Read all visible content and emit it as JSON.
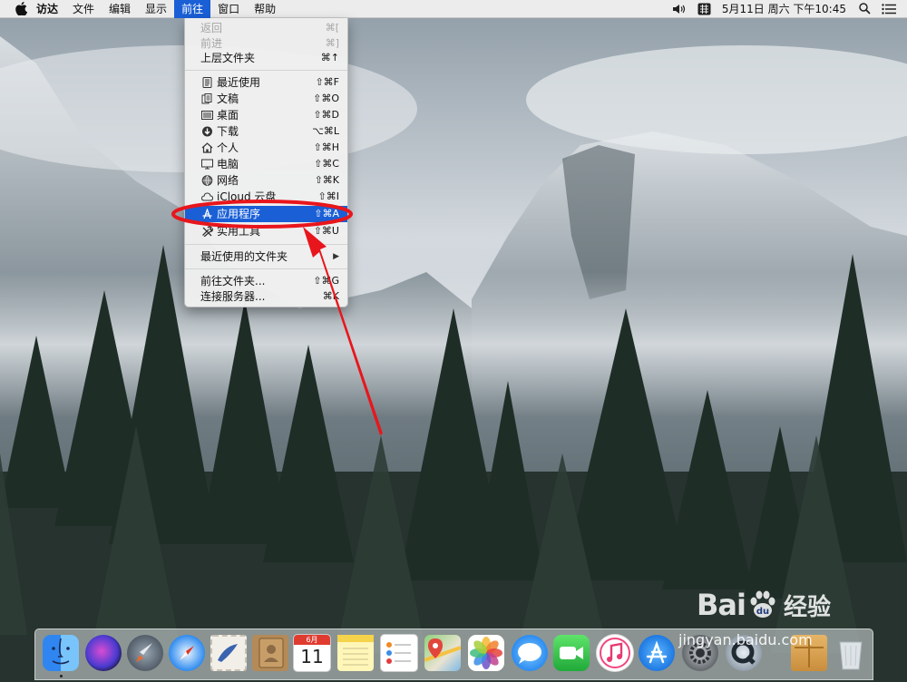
{
  "menubar": {
    "app_name": "访达",
    "items": [
      "文件",
      "编辑",
      "显示",
      "前往",
      "窗口",
      "帮助"
    ],
    "active_item": "前往",
    "clock": "5月11日 周六 下午10:45"
  },
  "go_menu": {
    "items": [
      {
        "label": "返回",
        "shortcut": "⌘[",
        "disabled": true,
        "icon": ""
      },
      {
        "label": "前进",
        "shortcut": "⌘]",
        "disabled": true,
        "icon": ""
      },
      {
        "label": "上层文件夹",
        "shortcut": "⌘↑",
        "disabled": false,
        "icon": ""
      },
      {
        "label": "最近使用",
        "shortcut": "⇧⌘F",
        "disabled": false,
        "icon": "recents-icon"
      },
      {
        "label": "文稿",
        "shortcut": "⇧⌘O",
        "disabled": false,
        "icon": "documents-icon"
      },
      {
        "label": "桌面",
        "shortcut": "⇧⌘D",
        "disabled": false,
        "icon": "desktop-icon"
      },
      {
        "label": "下载",
        "shortcut": "⌥⌘L",
        "disabled": false,
        "icon": "downloads-icon"
      },
      {
        "label": "个人",
        "shortcut": "⇧⌘H",
        "disabled": false,
        "icon": "home-icon"
      },
      {
        "label": "电脑",
        "shortcut": "⇧⌘C",
        "disabled": false,
        "icon": "computer-icon"
      },
      {
        "label": "网络",
        "shortcut": "⇧⌘K",
        "disabled": false,
        "icon": "network-icon"
      },
      {
        "label": "iCloud 云盘",
        "shortcut": "⇧⌘I",
        "disabled": false,
        "icon": "icloud-icon"
      },
      {
        "label": "应用程序",
        "shortcut": "⇧⌘A",
        "disabled": false,
        "icon": "applications-icon",
        "highlighted": true
      },
      {
        "label": "实用工具",
        "shortcut": "⇧⌘U",
        "disabled": false,
        "icon": "utilities-icon"
      },
      {
        "label": "最近使用的文件夹",
        "shortcut": "▶",
        "disabled": false,
        "icon": ""
      },
      {
        "label": "前往文件夹...",
        "shortcut": "⇧⌘G",
        "disabled": false,
        "icon": ""
      },
      {
        "label": "连接服务器...",
        "shortcut": "⌘K",
        "disabled": false,
        "icon": ""
      }
    ]
  },
  "dock": {
    "apps": [
      "finder-icon",
      "siri-icon",
      "launchpad-icon",
      "safari-icon",
      "mail-icon",
      "contacts-icon",
      "calendar-icon",
      "notes-icon",
      "reminders-icon",
      "maps-icon",
      "photos-icon",
      "messages-icon",
      "facetime-icon",
      "music-icon",
      "app-store-icon",
      "system-preferences-icon",
      "quicktime-icon",
      "package-icon",
      "trash-icon"
    ],
    "calendar": {
      "month": "6月",
      "day": "11"
    }
  },
  "watermark": {
    "brand": "Bai",
    "suffix": "经验",
    "url": "jingyan.baidu.com"
  },
  "colors": {
    "highlight": "#1a5fd6",
    "annotation": "#e8161c"
  }
}
